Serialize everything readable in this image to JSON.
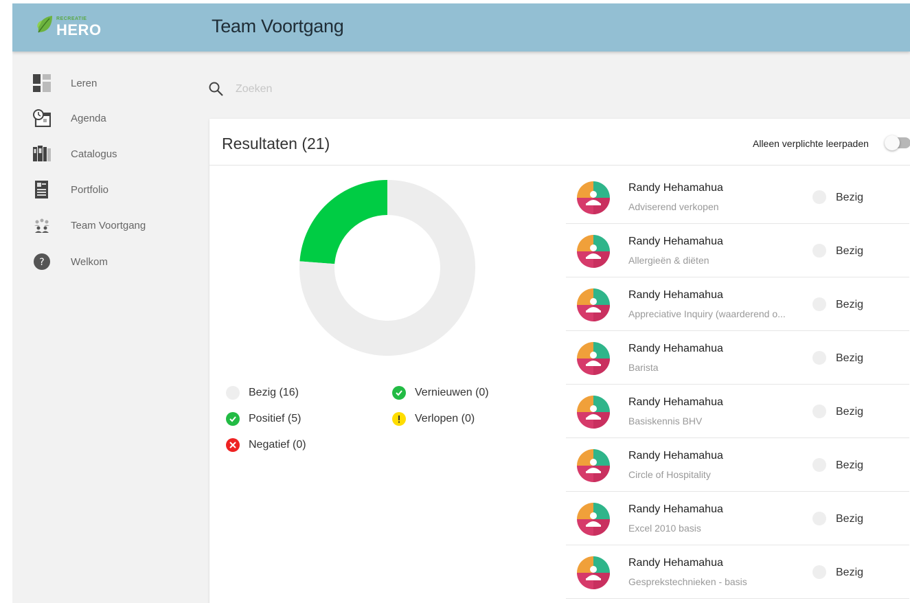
{
  "app": {
    "logo_small": "RECREATIE",
    "logo_big": "HERO",
    "page_title": "Team Voortgang",
    "header_color": "#93bfd3"
  },
  "sidebar": {
    "items": [
      {
        "label": "Leren",
        "icon": "dashboard-icon"
      },
      {
        "label": "Agenda",
        "icon": "calendar-clock-icon"
      },
      {
        "label": "Catalogus",
        "icon": "books-icon"
      },
      {
        "label": "Portfolio",
        "icon": "document-icon"
      },
      {
        "label": "Team Voortgang",
        "icon": "team-icon"
      },
      {
        "label": "Welkom",
        "icon": "help-icon"
      }
    ]
  },
  "search": {
    "placeholder": "Zoeken"
  },
  "results": {
    "title": "Resultaten (21)",
    "toggle_label": "Alleen verplichte leerpaden",
    "toggle_on": false
  },
  "chart_data": {
    "type": "pie",
    "labels": [
      "Positief",
      "Bezig"
    ],
    "values": [
      5,
      16
    ],
    "colors": [
      "#00cc44",
      "#ededed"
    ]
  },
  "legend": [
    {
      "label": "Bezig (16)",
      "status": "busy",
      "color": "#eeeeee"
    },
    {
      "label": "Vernieuwen (0)",
      "status": "renew",
      "color": "#22bb44"
    },
    {
      "label": "Positief (5)",
      "status": "positive",
      "color": "#22bb44"
    },
    {
      "label": "Verlopen (0)",
      "status": "expired",
      "color": "#ffdd00"
    },
    {
      "label": "Negatief (0)",
      "status": "negative",
      "color": "#ee2222"
    }
  ],
  "rows": [
    {
      "name": "Randy Hehamahua",
      "course": "Adviserend verkopen",
      "status": "Bezig"
    },
    {
      "name": "Randy Hehamahua",
      "course": "Allergieën & diëten",
      "status": "Bezig"
    },
    {
      "name": "Randy Hehamahua",
      "course": "Appreciative Inquiry (waarderend o...",
      "status": "Bezig"
    },
    {
      "name": "Randy Hehamahua",
      "course": "Barista",
      "status": "Bezig"
    },
    {
      "name": "Randy Hehamahua",
      "course": "Basiskennis BHV",
      "status": "Bezig"
    },
    {
      "name": "Randy Hehamahua",
      "course": "Circle of Hospitality",
      "status": "Bezig"
    },
    {
      "name": "Randy Hehamahua",
      "course": "Excel 2010 basis",
      "status": "Bezig"
    },
    {
      "name": "Randy Hehamahua",
      "course": "Gesprekstechnieken - basis",
      "status": "Bezig"
    }
  ]
}
